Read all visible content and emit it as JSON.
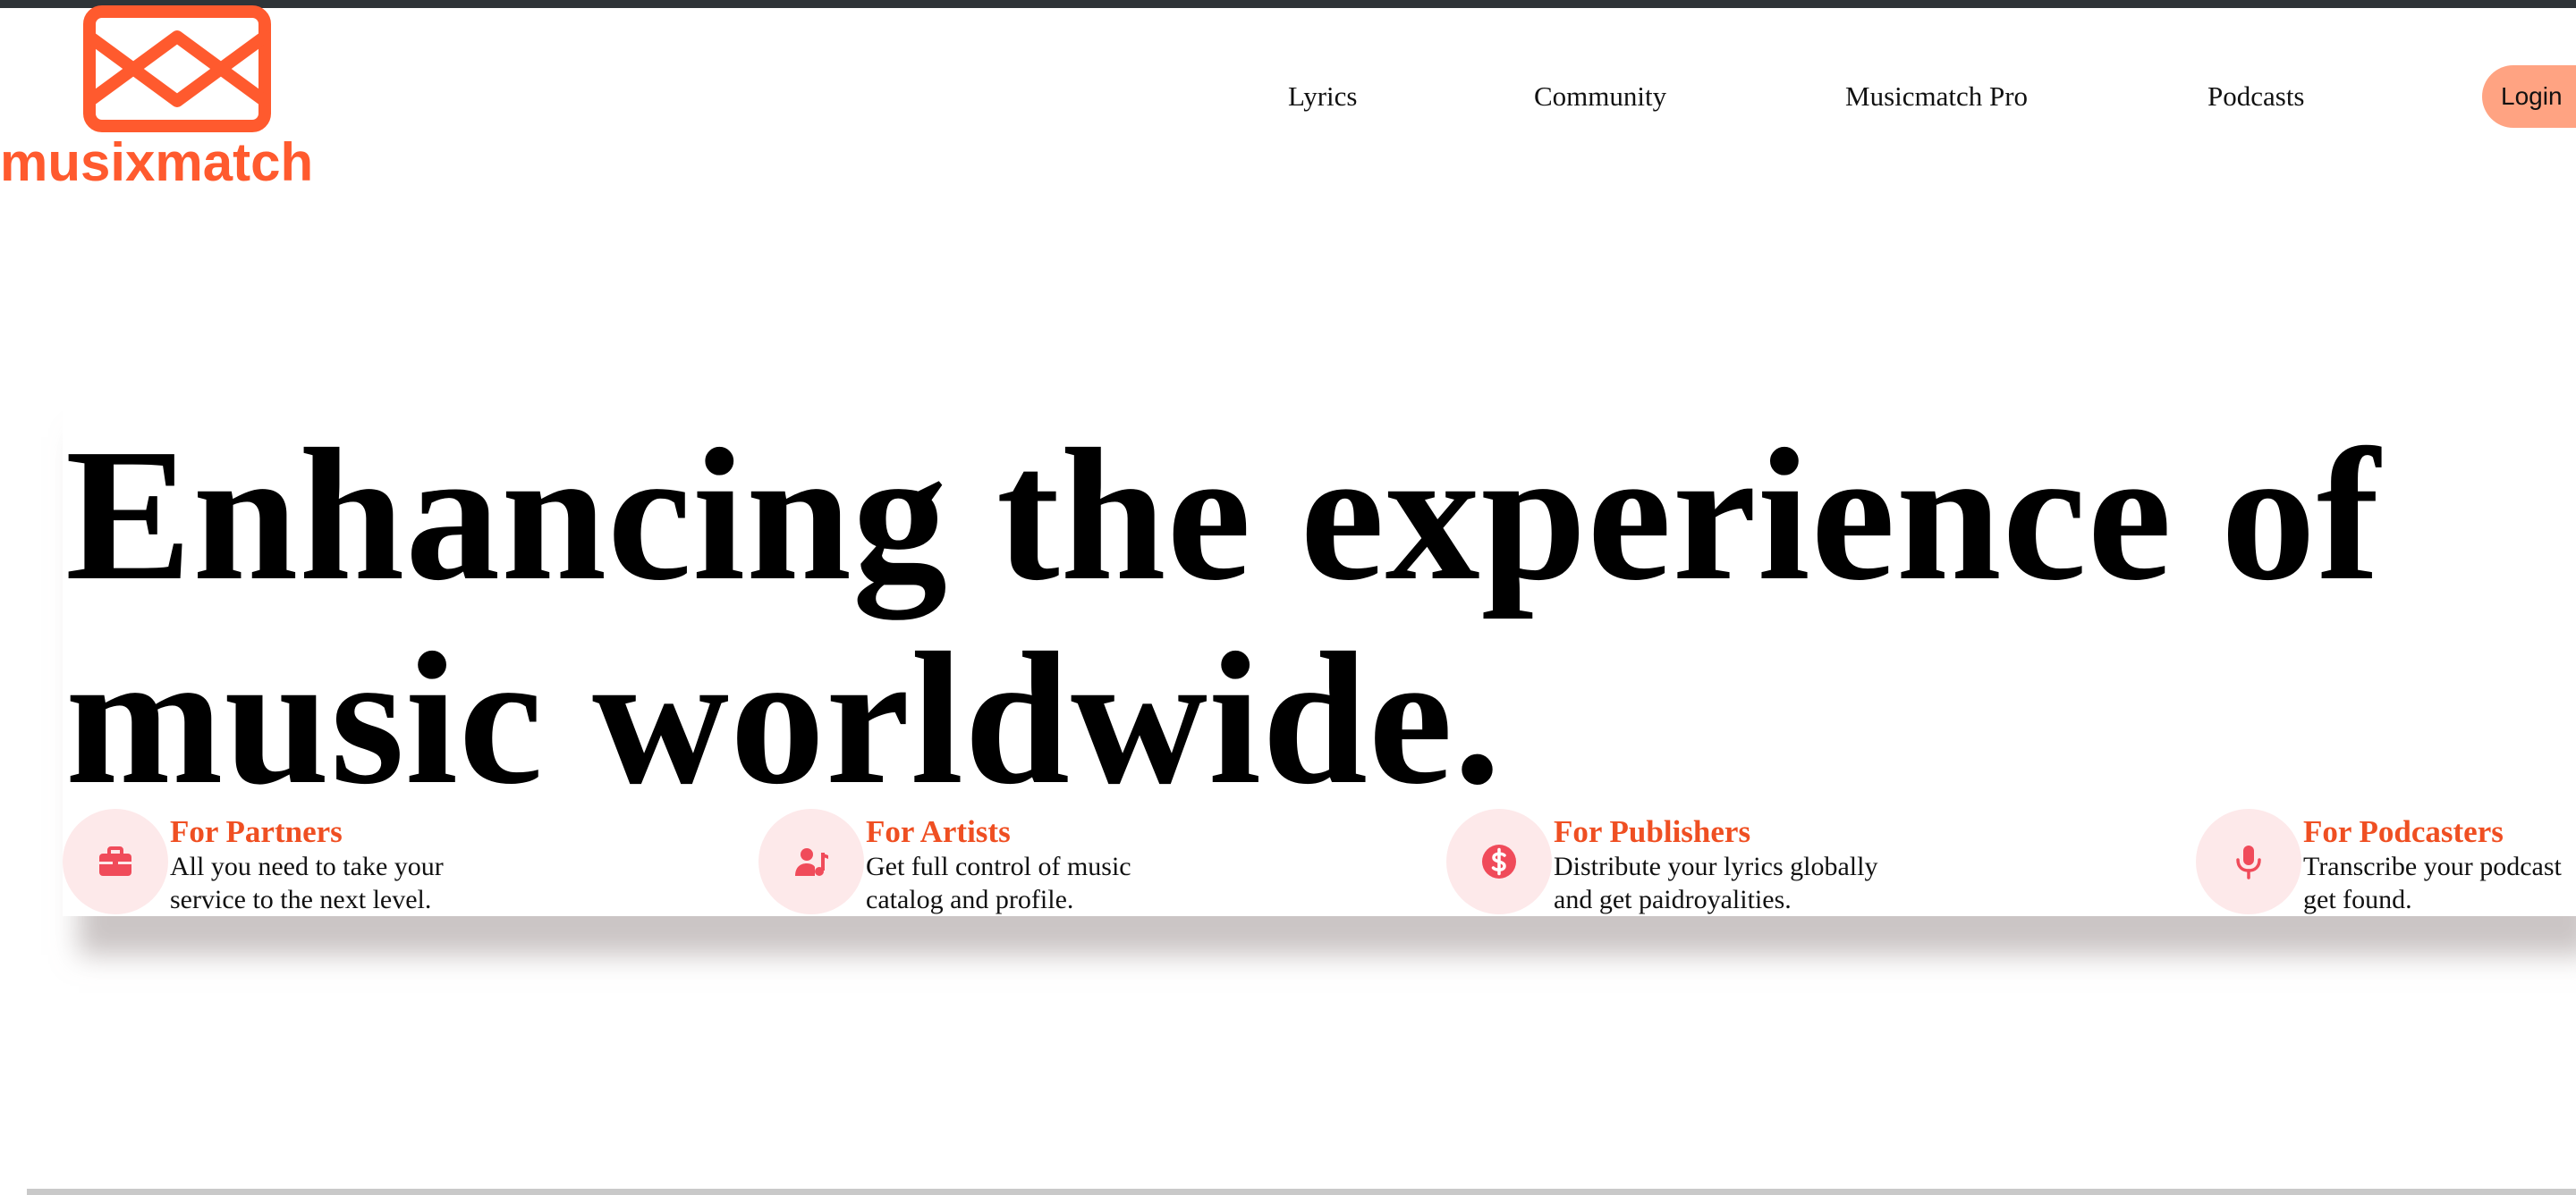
{
  "brand": {
    "name": "musixmatch",
    "color": "#ff5a2e"
  },
  "nav": {
    "items": [
      {
        "label": "Lyrics"
      },
      {
        "label": "Community"
      },
      {
        "label": "Musicmatch Pro"
      },
      {
        "label": "Podcasts"
      }
    ],
    "login_label": "Login",
    "login_color": "#ffa382"
  },
  "hero": {
    "line1": "Enhancing the experience of",
    "line2": "music worldwide."
  },
  "features": [
    {
      "icon": "briefcase-icon",
      "title": "For Partners",
      "desc_line1": "All you need to take your",
      "desc_line2": "service to the next level."
    },
    {
      "icon": "artist-music-icon",
      "title": "For Artists",
      "desc_line1": "Get full control of music",
      "desc_line2": "catalog and profile."
    },
    {
      "icon": "dollar-icon",
      "title": "For Publishers",
      "desc_line1": "Distribute your lyrics globally",
      "desc_line2": "and get paidroyalities."
    },
    {
      "icon": "microphone-icon",
      "title": "For Podcasters",
      "desc_line1": "Transcribe your podcast",
      "desc_line2": "get found."
    }
  ],
  "colors": {
    "accent": "#ef4f22",
    "icon_bg": "#fde9ea",
    "icon_fg": "#f04b5a"
  }
}
